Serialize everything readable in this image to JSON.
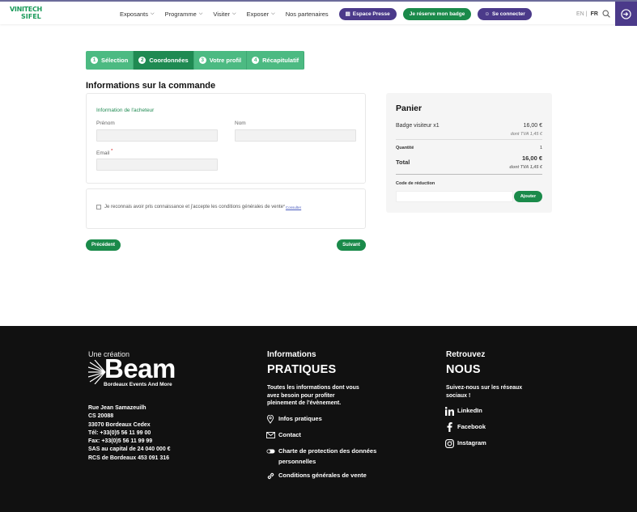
{
  "header": {
    "logo_line1": "VINITECH",
    "logo_line2": "SIFEL",
    "nav": [
      {
        "label": "Exposants"
      },
      {
        "label": "Programme"
      },
      {
        "label": "Visiter"
      },
      {
        "label": "Exposer"
      },
      {
        "label": "Nos partenaires"
      }
    ],
    "btn_press": "Espace Presse",
    "btn_badge": "Je réserve mon badge",
    "btn_login": "Se connecter",
    "lang_en": "EN",
    "lang_sep": "|",
    "lang_fr": "FR"
  },
  "steps": [
    {
      "num": "1",
      "label": "Sélection"
    },
    {
      "num": "2",
      "label": "Coordonnées"
    },
    {
      "num": "3",
      "label": "Votre profil"
    },
    {
      "num": "4",
      "label": "Récapitulatif"
    }
  ],
  "section_title": "Informations sur la commande",
  "buyer": {
    "title": "Information de l'acheteur",
    "firstname_label": "Prénom",
    "lastname_label": "Nom",
    "email_label": "Email",
    "required_mark": "*"
  },
  "terms": {
    "text": "Je reconnais avoir pris connaissance et j'accepte les conditions générales de vente",
    "required_mark": "*",
    "link": "Consulter"
  },
  "actions": {
    "prev": "Précédent",
    "next": "Suivant"
  },
  "cart": {
    "title": "Panier",
    "item_label": "Badge visiteur x1",
    "item_price": "16,00 €",
    "item_tva": "dont TVA 1,45 €",
    "qty_label": "Quantité",
    "qty_value": "1",
    "total_label": "Total",
    "total_value": "16,00 €",
    "total_tva": "dont TVA 1,45 €",
    "discount_label": "Code de réduction",
    "discount_button": "Ajouter"
  },
  "footer": {
    "beam_pre": "Une création",
    "beam_word": "Beam",
    "beam_sub": "Bordeaux Events And More",
    "address": [
      "Rue Jean Samazeuilh",
      "CS 20088",
      "33070 Bordeaux Cedex",
      "Tél: +33(0)5 56 11 99 00",
      "Fax: +33(0)5 56 11 99 99",
      "SAS au capital de 24 040 000 €",
      "RCS de Bordeaux 453 091 316"
    ],
    "info_title1": "Informations",
    "info_title2": "PRATIQUES",
    "info_text": [
      "Toutes les informations dont vous",
      "avez besoin pour profiter",
      "pleinement de l'évènement."
    ],
    "info_links": [
      {
        "label": "Infos pratiques",
        "icon": "location-pin-icon"
      },
      {
        "label": "Contact",
        "icon": "mail-icon"
      },
      {
        "label": "Charte de protection des données personnelles",
        "icon": "toggle-icon"
      },
      {
        "label": "Conditions générales de vente",
        "icon": "link-icon"
      }
    ],
    "social_title1": "Retrouvez",
    "social_title2": "NOUS",
    "social_text": [
      "Suivez-nous sur les réseaux",
      "sociaux !"
    ],
    "social_links": [
      {
        "label": "LinkedIn",
        "icon": "linkedin-icon"
      },
      {
        "label": "Facebook",
        "icon": "facebook-icon"
      },
      {
        "label": "Instagram",
        "icon": "instagram-icon"
      }
    ]
  },
  "colors": {
    "brand_green": "#1a8a4a",
    "step_green": "#4cba82",
    "brand_purple": "#4b3a8a",
    "footer_bg": "#111111"
  }
}
